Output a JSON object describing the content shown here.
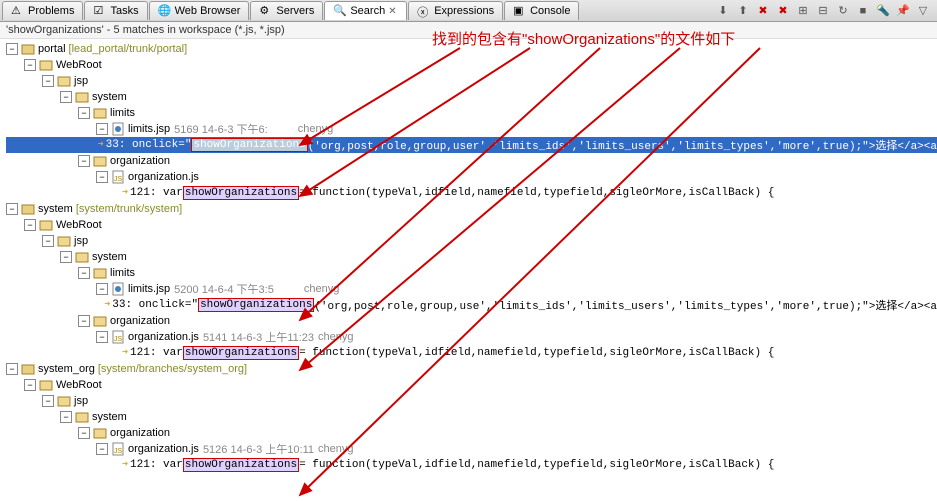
{
  "tabs": [
    {
      "label": "Problems"
    },
    {
      "label": "Tasks"
    },
    {
      "label": "Web Browser"
    },
    {
      "label": "Servers"
    },
    {
      "label": "Search",
      "active": true,
      "close": true
    },
    {
      "label": "Expressions"
    },
    {
      "label": "Console"
    }
  ],
  "status": "'showOrganizations' - 5 matches in workspace (*.js, *.jsp)",
  "annotation": "找到的包含有\"showOrganizations\"的文件如下",
  "tree": {
    "p1": {
      "name": "portal",
      "path": "[lead_portal/trunk/portal]",
      "webroot": "WebRoot",
      "jsp": "jsp",
      "system": "system",
      "limits": "limits",
      "limits_file": "limits.jsp",
      "limits_rev": "5169  14-6-3 下午6:",
      "limits_author": "chenyg",
      "limits_match_pre": "33: onclick=\"",
      "limits_match_hl": "showOrganizations",
      "limits_match_post": "('org,post,role,group,user','limits_ids','limits_users','limits_types','more',true);\">选择</a><a",
      "org": "organization",
      "org_file": "organization.js",
      "org_match_pre": "121: var ",
      "org_match_hl": "showOrganizations",
      "org_match_post": " = function(typeVal,idfield,namefield,typefield,sigleOrMore,isCallBack) {"
    },
    "p2": {
      "name": "system",
      "path": "[system/trunk/system]",
      "webroot": "WebRoot",
      "jsp": "jsp",
      "system": "system",
      "limits": "limits",
      "limits_file": "limits.jsp",
      "limits_rev": "5200  14-6-4 下午3:5",
      "limits_author": "chenyg",
      "limits_match_pre": "33: onclick=\"",
      "limits_match_hl": "showOrganizations",
      "limits_match_post": "('org,post,role,group,use','limits_ids','limits_users','limits_types','more',true);\">选择</a><a",
      "org": "organization",
      "org_file": "organization.js",
      "org_rev": "5141  14-6-3 上午11:23",
      "org_author": "chenyg",
      "org_match_pre": "121: var ",
      "org_match_hl": "showOrganizations",
      "org_match_post": " = function(typeVal,idfield,namefield,typefield,sigleOrMore,isCallBack) {"
    },
    "p3": {
      "name": "system_org",
      "path": "[system/branches/system_org]",
      "webroot": "WebRoot",
      "jsp": "jsp",
      "system": "system",
      "org": "organization",
      "org_file": "organization.js",
      "org_rev": "5126  14-6-3 上午10:11",
      "org_author": "chenyg",
      "org_match_pre": "121: var ",
      "org_match_hl": "showOrganizations",
      "org_match_post": " = function(typeVal,idfield,namefield,typefield,sigleOrMore,isCallBack) {"
    }
  }
}
